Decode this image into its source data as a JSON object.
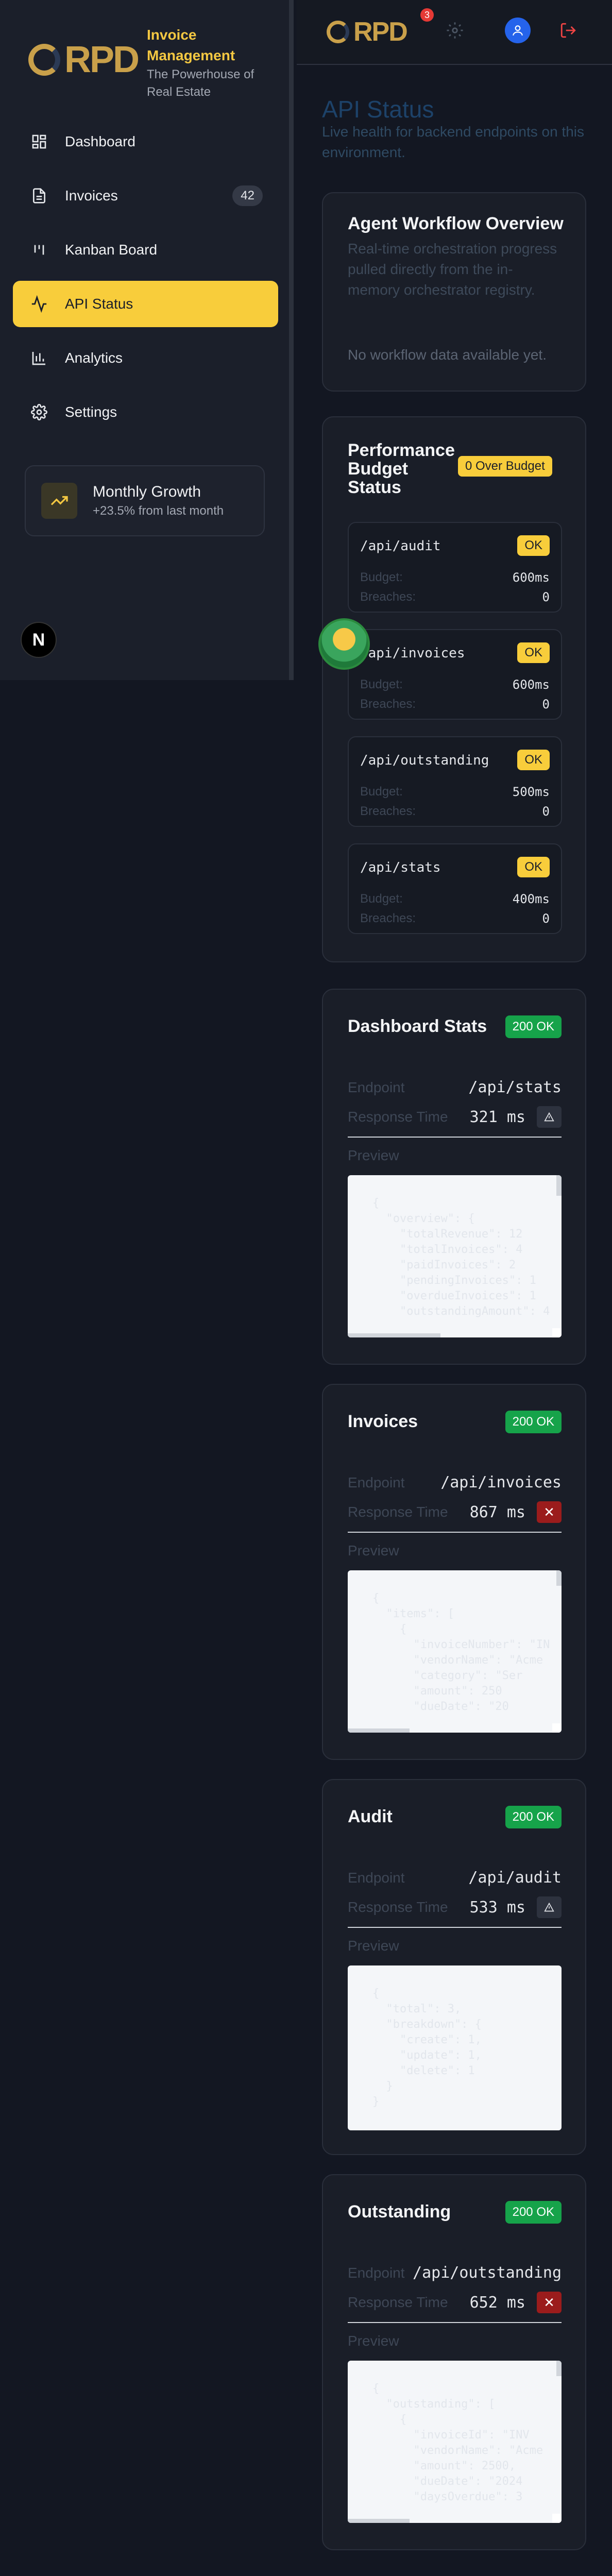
{
  "brand": {
    "logo_text": "RPD",
    "title": "Invoice Management",
    "subtitle": "The Powerhouse of Real Estate"
  },
  "nav": {
    "items": [
      {
        "label": "Dashboard",
        "icon": "dashboard-icon"
      },
      {
        "label": "Invoices",
        "icon": "document-icon",
        "badge": "42"
      },
      {
        "label": "Kanban Board",
        "icon": "kanban-icon"
      },
      {
        "label": "API Status",
        "icon": "activity-icon",
        "active": true
      },
      {
        "label": "Analytics",
        "icon": "bar-chart-icon"
      },
      {
        "label": "Settings",
        "icon": "gear-icon"
      }
    ]
  },
  "growth": {
    "title": "Monthly Growth",
    "subtitle": "+23.5% from last month"
  },
  "n_badge": "N",
  "header": {
    "logo_text": "RPD",
    "notification_count": "3"
  },
  "page": {
    "title": "API Status",
    "subtitle": "Live health for backend endpoints on this environment."
  },
  "agent": {
    "title": "Agent Workflow Overview",
    "description": "Real-time orchestration progress pulled directly from the in-memory orchestrator registry.",
    "empty": "No workflow data available yet."
  },
  "perf": {
    "title": "Performance Budget Status",
    "badge": "0 Over Budget",
    "budget_label": "Budget:",
    "breaches_label": "Breaches:",
    "endpoints": [
      {
        "name": "/api/audit",
        "status": "OK",
        "budget": "600ms",
        "breaches": "0"
      },
      {
        "name": "/api/invoices",
        "status": "OK",
        "budget": "600ms",
        "breaches": "0"
      },
      {
        "name": "/api/outstanding",
        "status": "OK",
        "budget": "500ms",
        "breaches": "0"
      },
      {
        "name": "/api/stats",
        "status": "OK",
        "budget": "400ms",
        "breaches": "0"
      }
    ]
  },
  "labels": {
    "endpoint": "Endpoint",
    "response_time": "Response Time",
    "preview": "Preview"
  },
  "stats": [
    {
      "title": "Dashboard Stats",
      "status": "200 OK",
      "endpoint": "/api/stats",
      "response_time": "321 ms",
      "flag": "warning",
      "preview": "{\n  \"overview\": {\n    \"totalRevenue\": 12\n    \"totalInvoices\": 4\n    \"paidInvoices\": 2\n    \"pendingInvoices\": 1\n    \"overdueInvoices\": 1\n    \"outstandingAmount\": 4"
    },
    {
      "title": "Invoices",
      "status": "200 OK",
      "endpoint": "/api/invoices",
      "response_time": "867 ms",
      "flag": "error",
      "preview": "{\n  \"items\": [\n    {\n      \"invoiceNumber\": \"IN\n      \"vendorName\": \"Acme\n      \"category\": \"Ser\n      \"amount\": 250\n      \"dueDate\": \"20"
    },
    {
      "title": "Audit",
      "status": "200 OK",
      "endpoint": "/api/audit",
      "response_time": "533 ms",
      "flag": "warning",
      "preview": "{\n  \"total\": 3,\n  \"breakdown\": {\n    \"create\": 1,\n    \"update\": 1,\n    \"delete\": 1\n  }\n}"
    },
    {
      "title": "Outstanding",
      "status": "200 OK",
      "endpoint": "/api/outstanding",
      "response_time": "652 ms",
      "flag": "error",
      "preview": "{\n  \"outstanding\": [\n    {\n      \"invoiceId\": \"INV\n      \"vendorName\": \"Acme\n      \"amount\": 2500,\n      \"dueDate\": \"2024\n      \"daysOverdue\": 3"
    }
  ]
}
